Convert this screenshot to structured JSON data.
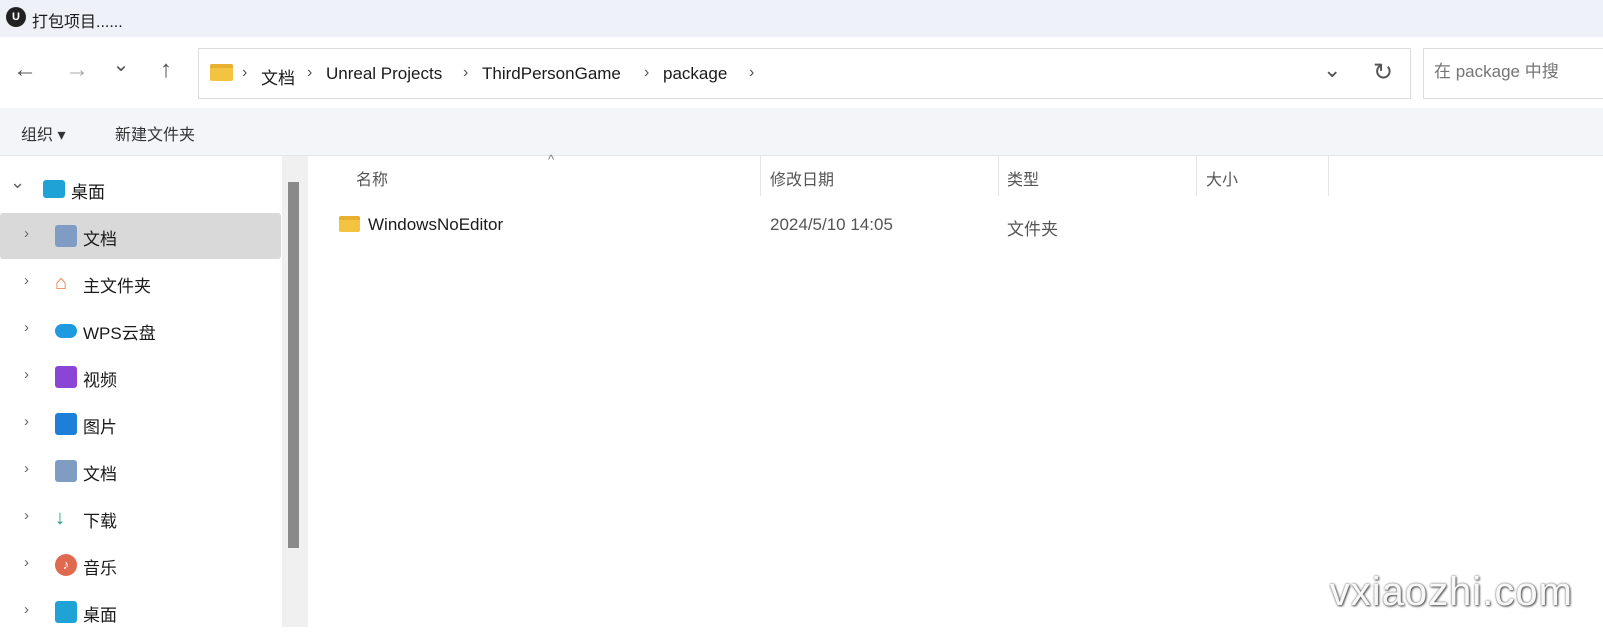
{
  "window": {
    "title": "打包项目......",
    "logo": "U"
  },
  "nav": {
    "back": "←",
    "forward": "→",
    "recent": "⌄",
    "up": "↑"
  },
  "address": {
    "crumbs": [
      "文档",
      "Unreal Projects",
      "ThirdPersonGame",
      "package"
    ],
    "dropdown": "⌄",
    "refresh": "↻"
  },
  "search": {
    "placeholder": "在 package 中搜"
  },
  "toolbar": {
    "organize": "组织 ▾",
    "new_folder": "新建文件夹"
  },
  "sidebar": {
    "items": [
      {
        "label": "桌面",
        "icon": "desktop-icon",
        "expanded": true,
        "color": "#1fa3d6"
      },
      {
        "label": "文档",
        "icon": "documents-icon",
        "selected": true,
        "color": "#7f9cc2"
      },
      {
        "label": "主文件夹",
        "icon": "home-icon",
        "color": "#e9783a"
      },
      {
        "label": "WPS云盘",
        "icon": "cloud-icon",
        "color": "#1e9be0"
      },
      {
        "label": "视频",
        "icon": "video-icon",
        "color": "#8a45d6"
      },
      {
        "label": "图片",
        "icon": "pictures-icon",
        "color": "#1e7fd8"
      },
      {
        "label": "文档",
        "icon": "documents-icon",
        "color": "#7f9cc2"
      },
      {
        "label": "下载",
        "icon": "download-icon",
        "color": "#1a9a7a"
      },
      {
        "label": "音乐",
        "icon": "music-icon",
        "color": "#e06a50"
      },
      {
        "label": "桌面",
        "icon": "desktop-icon",
        "color": "#1fa3d6"
      }
    ]
  },
  "columns": [
    "名称",
    "修改日期",
    "类型",
    "大小"
  ],
  "files": [
    {
      "name": "WindowsNoEditor",
      "modified": "2024/5/10 14:05",
      "type": "文件夹",
      "size": ""
    }
  ],
  "watermark": "vxiaozhi.com"
}
